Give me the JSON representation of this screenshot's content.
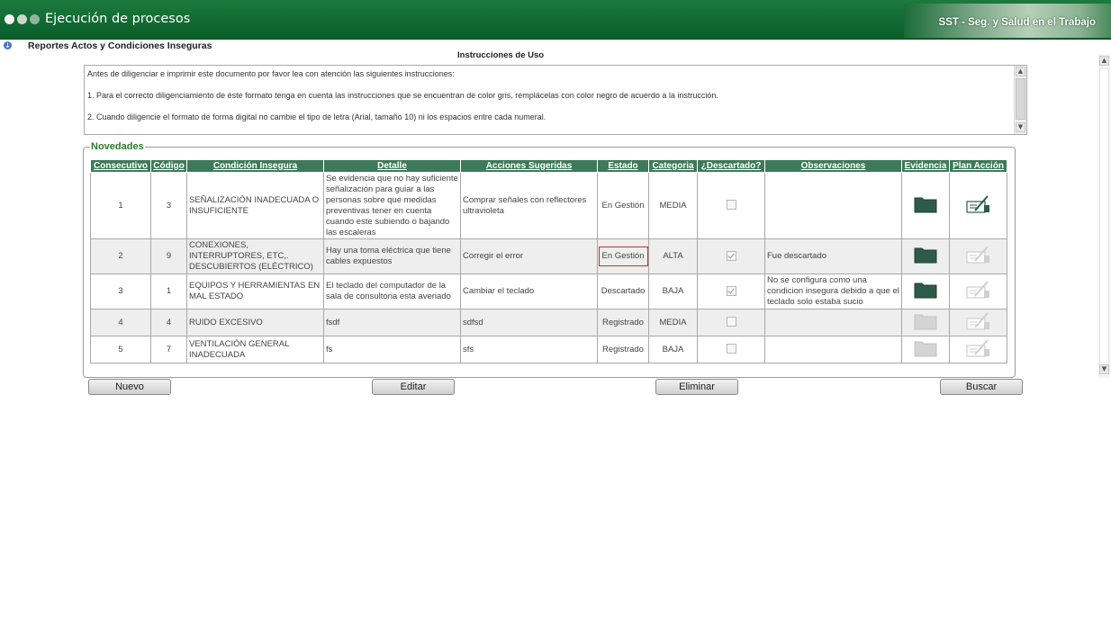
{
  "header": {
    "app_title": "Ejecución de procesos",
    "brand_text": "SST - Seg. y Salud en el Trabajo"
  },
  "breadcrumb": {
    "label": "Reportes Actos y Condiciones Inseguras"
  },
  "instructions": {
    "title": "Instrucciones de Uso",
    "lines": [
      "Antes de diligenciar e imprimir este documento por favor lea con atención las siguientes instrucciones:",
      "1. Para el correcto diligenciamiento de éste formato tenga en cuenta las instrucciones que se encuentran de color gris, remplácelas con color negro de acuerdo a la instrucción.",
      "2. Cuando diligencie el formato de forma digital no cambie el tipo de letra (Arial, tamaño 10) ni los espacios entre cada numeral."
    ]
  },
  "novedades": {
    "legend": "Novedades",
    "columns": [
      "Consecutivo",
      "Código",
      "Condición Insegura",
      "Detalle",
      "Acciones Sugeridas",
      "Estado",
      "Categoria",
      "¿Descartado?",
      "Observaciones",
      "Evidencia",
      "Plan Acción"
    ],
    "rows": [
      {
        "consecutivo": "1",
        "codigo": "3",
        "condicion": "SEÑALIZACIÓN INADECUADA O INSUFICIENTE",
        "detalle": "Se evidencia que no hay suficiente señalización para guiar a las personas sobre que medidas preventivas tener en cuenta cuando este subiendo o bajando las escaleras",
        "acciones": "Comprar señales con reflectores ultravioleta",
        "estado": "En Gestión",
        "categoria": "MEDIA",
        "descartado": false,
        "observaciones": "",
        "evidencia_icon": "folder-icon",
        "evidencia_enabled": true,
        "plan_icon": "edit-plan-icon",
        "plan_enabled": true
      },
      {
        "consecutivo": "2",
        "codigo": "9",
        "condicion": "CONEXIONES, INTERRUPTORES, ETC,. DESCUBIERTOS (ELÉCTRICO)",
        "detalle": "Hay una toma eléctrica que tiene cables expuestos",
        "acciones": "Corregir el error",
        "estado": "En Gestión",
        "categoria": "ALTA",
        "descartado": true,
        "observaciones": "Fue descartado",
        "evidencia_icon": "folder-icon",
        "evidencia_enabled": true,
        "plan_icon": "edit-plan-icon",
        "plan_enabled": false
      },
      {
        "consecutivo": "3",
        "codigo": "1",
        "condicion": "EQUIPOS Y HERRAMIENTAS EN MAL ESTADO",
        "detalle": "El teclado del computador de la sala de consultoria esta averiado",
        "acciones": "Cambiar el teclado",
        "estado": "Descartado",
        "categoria": "BAJA",
        "descartado": true,
        "observaciones": "No se configura como una condicion insegura debido a que el teclado solo estaba sucio",
        "evidencia_icon": "folder-icon",
        "evidencia_enabled": true,
        "plan_icon": "edit-plan-icon",
        "plan_enabled": false
      },
      {
        "consecutivo": "4",
        "codigo": "4",
        "condicion": "RUIDO EXCESIVO",
        "detalle": "fsdf",
        "acciones": "sdfsd",
        "estado": "Registrado",
        "categoria": "MEDIA",
        "descartado": false,
        "observaciones": "",
        "evidencia_icon": "folder-icon",
        "evidencia_enabled": false,
        "plan_icon": "edit-plan-icon",
        "plan_enabled": false
      },
      {
        "consecutivo": "5",
        "codigo": "7",
        "condicion": "VENTILACIÓN GENERAL INADECUADA",
        "detalle": "fs",
        "acciones": "sfs",
        "estado": "Registrado",
        "categoria": "BAJA",
        "descartado": false,
        "observaciones": "",
        "evidencia_icon": "folder-icon",
        "evidencia_enabled": false,
        "plan_icon": "edit-plan-icon",
        "plan_enabled": false
      }
    ],
    "highlighted_cell": "Row 2 Estado"
  },
  "buttons": {
    "nuevo": "Nuevo",
    "editar": "Editar",
    "eliminar": "Eliminar",
    "buscar": "Buscar"
  },
  "colors": {
    "header_green": "#0f6a32",
    "table_header": "#3d7a5a",
    "legend_green": "#2d7a2d",
    "folder_active": "#2e5a4a",
    "folder_disabled": "#d4d4d4",
    "highlight_red": "#d32a2a"
  }
}
